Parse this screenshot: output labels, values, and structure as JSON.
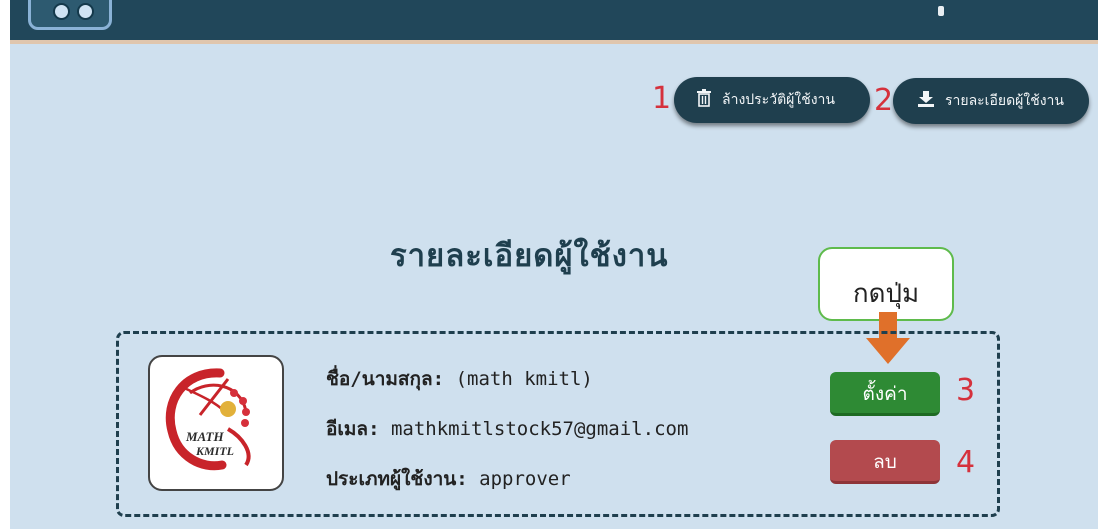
{
  "header": {
    "logo_icon": "app-logo-icon"
  },
  "toolbar": {
    "clear_history": {
      "number": "1",
      "label": "ล้างประวัติผู้ใช้งาน",
      "icon": "trash-icon"
    },
    "user_details": {
      "number": "2",
      "label": "รายละเอียดผู้ใช้งาน",
      "icon": "download-icon"
    }
  },
  "main": {
    "title": "รายละเอียดผู้ใช้งาน",
    "callout": {
      "text": "กดปุ่ม",
      "border_color": "#5fbb4c",
      "arrow_color": "#e0702a"
    },
    "user": {
      "name_label": "ชื่อ/นามสกุล:",
      "name_value": "(math kmitl)",
      "email_label": "อีเมล:",
      "email_value": "mathkmitlstock57@gmail.com",
      "type_label": "ประเภทผู้ใช้งาน:",
      "type_value": "approver",
      "avatar": {
        "logo_text_1": "MATH",
        "logo_text_2": "KMITL"
      }
    },
    "settings_button": {
      "number": "3",
      "label": "ตั้งค่า",
      "color": "#2e8a34"
    },
    "delete_button": {
      "number": "4",
      "label": "ลบ",
      "color": "#b34a4e"
    }
  },
  "colors": {
    "background": "#cfe0ee",
    "header": "#21475a",
    "annotation_red": "#d5313c"
  }
}
